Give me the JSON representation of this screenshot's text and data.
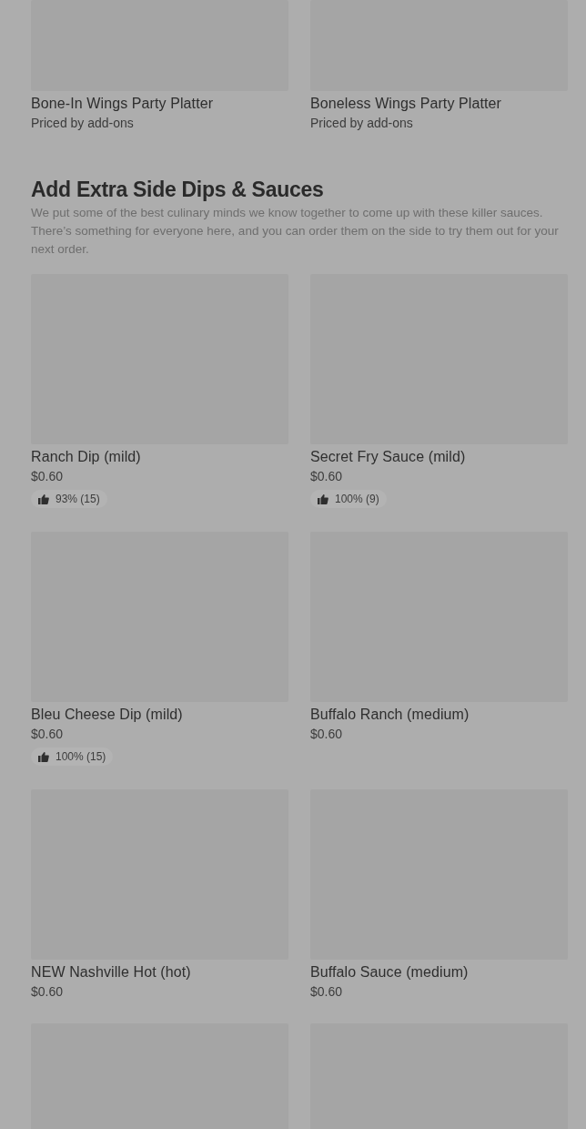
{
  "top_items": [
    {
      "name": "Bone-In Wings Party Platter",
      "subtitle": "Priced by add-ons"
    },
    {
      "name": "Boneless Wings Party Platter",
      "subtitle": "Priced by add-ons"
    }
  ],
  "section": {
    "title": "Add Extra Side Dips & Sauces",
    "description": "We put some of the best culinary minds we know together to come up with these killer sauces. There’s something for everyone here, and you can order them on the side to try them out for your next order.",
    "items": [
      {
        "kind": "item",
        "name": "Ranch Dip (mild)",
        "price": "$0.60",
        "rating": "93% (15)"
      },
      {
        "kind": "item",
        "name": "Secret Fry Sauce (mild)",
        "price": "$0.60",
        "rating": "100% (9)"
      },
      {
        "kind": "item",
        "name": "Bleu Cheese Dip (mild)",
        "price": "$0.60",
        "rating": "100% (15)"
      },
      {
        "kind": "item",
        "name": "Buffalo Ranch (medium)",
        "price": "$0.60"
      },
      {
        "kind": "item",
        "name": "NEW Nashville Hot (hot)",
        "price": "$0.60"
      },
      {
        "kind": "item",
        "name": "Buffalo Sauce (medium)",
        "price": "$0.60"
      },
      {
        "kind": "picture"
      },
      {
        "kind": "picture"
      }
    ]
  }
}
